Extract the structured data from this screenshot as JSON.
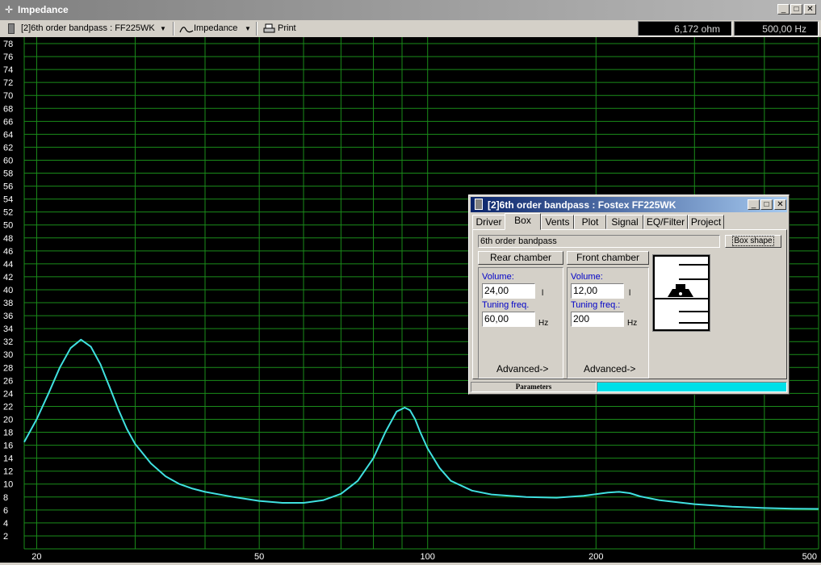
{
  "window": {
    "title": "Impedance"
  },
  "toolbar": {
    "project_selector": "[2]6th order bandpass : FF225WK",
    "graph_selector": "Impedance",
    "print_label": "Print",
    "readout_value": "6,172 ohm",
    "readout_freq": "500,00 Hz"
  },
  "chart_data": {
    "type": "line",
    "title": "Impedance",
    "xlabel": "",
    "ylabel": "",
    "x_scale": "log",
    "xlim": [
      19,
      500
    ],
    "ylim": [
      0,
      79
    ],
    "x_tick_labels": [
      "20",
      "50",
      "100",
      "200",
      "500"
    ],
    "y_tick_labels": [
      "2",
      "4",
      "6",
      "8",
      "10",
      "12",
      "14",
      "16",
      "18",
      "20",
      "22",
      "24",
      "26",
      "28",
      "30",
      "32",
      "34",
      "36",
      "38",
      "40",
      "42",
      "44",
      "46",
      "48",
      "50",
      "52",
      "54",
      "56",
      "58",
      "60",
      "62",
      "64",
      "66",
      "68",
      "70",
      "72",
      "74",
      "76",
      "78"
    ],
    "grid": true,
    "colors": {
      "background": "#000000",
      "grid": "#1a8c1a",
      "line": "#40e0e0",
      "labels": "#ffffff"
    },
    "series": [
      {
        "x": [
          19,
          20,
          21,
          22,
          23,
          24,
          25,
          26,
          27,
          28,
          29,
          30,
          32,
          34,
          36,
          38,
          40,
          45,
          50,
          55,
          60,
          65,
          70,
          75,
          80,
          84,
          88,
          91,
          93,
          95,
          97,
          100,
          105,
          110,
          120,
          130,
          150,
          170,
          190,
          210,
          220,
          230,
          240,
          260,
          300,
          350,
          400,
          450,
          500
        ],
        "y": [
          16.5,
          20,
          24,
          28,
          31,
          32.3,
          31.2,
          28.5,
          25,
          21.5,
          18.5,
          16.2,
          13.2,
          11.2,
          10,
          9.3,
          8.8,
          8,
          7.4,
          7.1,
          7.1,
          7.5,
          8.5,
          10.5,
          14,
          18,
          21.2,
          21.8,
          21.4,
          20,
          18,
          15.5,
          12.5,
          10.5,
          9,
          8.4,
          8,
          7.9,
          8.2,
          8.7,
          8.8,
          8.6,
          8.1,
          7.5,
          6.9,
          6.5,
          6.3,
          6.2,
          6.17
        ]
      }
    ]
  },
  "dialog": {
    "title": "[2]6th order bandpass : Fostex FF225WK",
    "tabs": [
      "Driver",
      "Box",
      "Vents",
      "Plot",
      "Signal",
      "EQ/Filter",
      "Project"
    ],
    "active_tab": "Box",
    "box_type": "6th order bandpass",
    "box_shape_button": "Box shape",
    "rear": {
      "header": "Rear chamber",
      "volume_label": "Volume:",
      "volume_value": "24,00",
      "volume_unit": "l",
      "tuning_label": "Tuning freq.",
      "tuning_value": "60,00",
      "tuning_unit": "Hz",
      "advanced": "Advanced->"
    },
    "front": {
      "header": "Front chamber",
      "volume_label": "Volume:",
      "volume_value": "12,00",
      "volume_unit": "l",
      "tuning_label": "Tuning freq.:",
      "tuning_value": "200",
      "tuning_unit": "Hz",
      "advanced": "Advanced->"
    },
    "status_label": "Parameters",
    "progress_fraction": 1.0
  }
}
